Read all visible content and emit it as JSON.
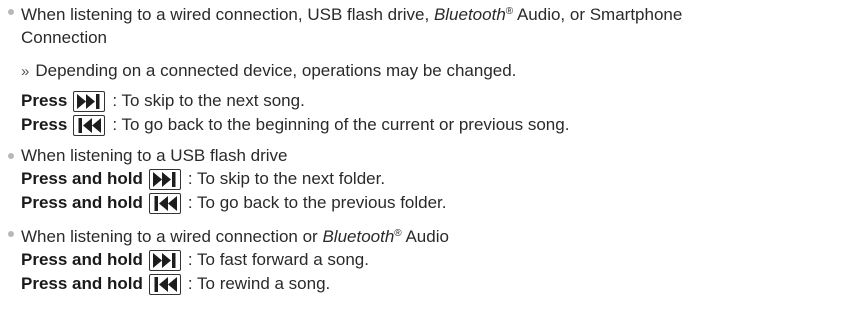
{
  "section1": {
    "heading_a": "When listening to a wired connection, USB flash drive, ",
    "heading_bt": "Bluetooth",
    "heading_reg": "®",
    "heading_b": " Audio, or Smartphone",
    "heading_line2": "Connection",
    "note_arrow": "»",
    "note": "Depending on a connected device, operations may be changed.",
    "cmd1": {
      "action": "Press",
      "key_icon": "skip-next-icon",
      "desc": ": To skip to the next song."
    },
    "cmd2": {
      "action": "Press",
      "key_icon": "skip-previous-icon",
      "desc": ": To go back to the beginning of the current or previous song."
    }
  },
  "section2": {
    "heading": "When listening to a USB flash drive",
    "cmd1": {
      "action": "Press and hold",
      "key_icon": "skip-next-icon",
      "desc": ": To skip to the next folder."
    },
    "cmd2": {
      "action": "Press and hold",
      "key_icon": "skip-previous-icon",
      "desc": ": To go back to the previous folder."
    }
  },
  "section3": {
    "heading_a": "When listening to a wired connection or ",
    "heading_bt": "Bluetooth",
    "heading_reg": "®",
    "heading_b": " Audio",
    "cmd1": {
      "action": "Press and hold",
      "key_icon": "skip-next-icon",
      "desc": ": To fast forward a song."
    },
    "cmd2": {
      "action": "Press and hold",
      "key_icon": "skip-previous-icon",
      "desc": ": To rewind a song."
    }
  }
}
